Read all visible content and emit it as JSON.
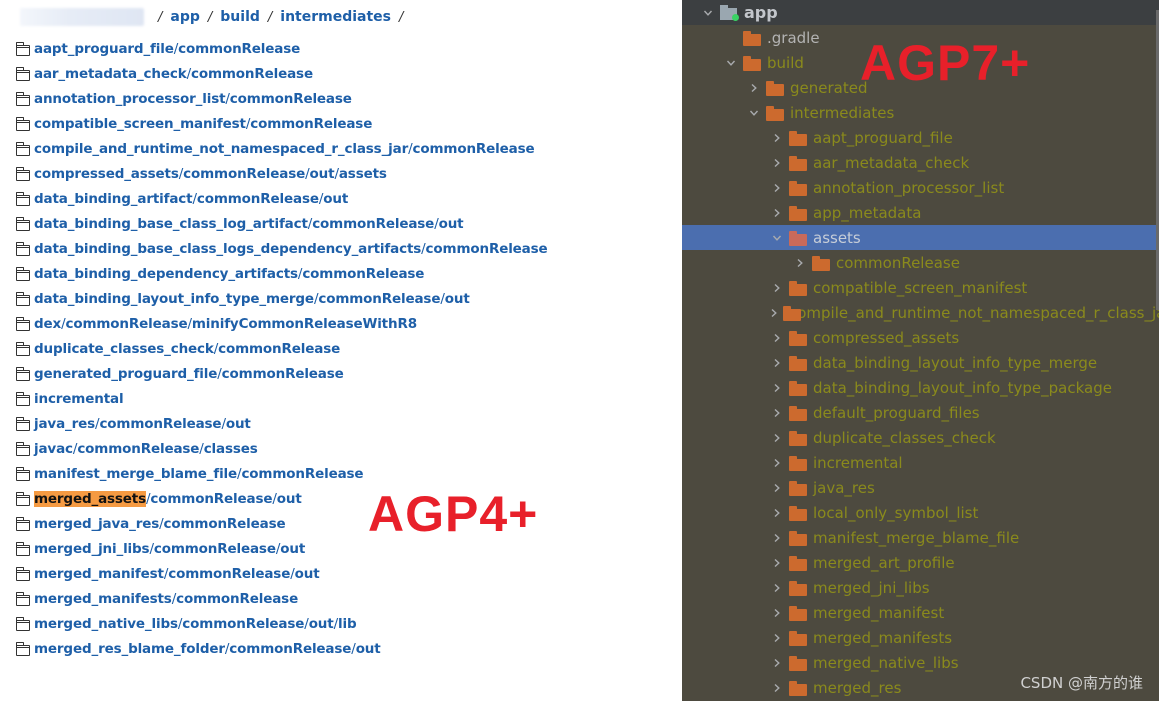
{
  "left_panel": {
    "breadcrumb": {
      "items": [
        "app",
        "build",
        "intermediates"
      ],
      "separator": "/"
    },
    "entries": [
      {
        "segments": [
          "aapt_proguard_file",
          "commonRelease"
        ]
      },
      {
        "segments": [
          "aar_metadata_check",
          "commonRelease"
        ]
      },
      {
        "segments": [
          "annotation_processor_list",
          "commonRelease"
        ]
      },
      {
        "segments": [
          "compatible_screen_manifest",
          "commonRelease"
        ]
      },
      {
        "segments": [
          "compile_and_runtime_not_namespaced_r_class_jar",
          "commonRelease"
        ]
      },
      {
        "segments": [
          "compressed_assets",
          "commonRelease",
          "out",
          "assets"
        ]
      },
      {
        "segments": [
          "data_binding_artifact",
          "commonRelease",
          "out"
        ]
      },
      {
        "segments": [
          "data_binding_base_class_log_artifact",
          "commonRelease",
          "out"
        ]
      },
      {
        "segments": [
          "data_binding_base_class_logs_dependency_artifacts",
          "commonRelease"
        ]
      },
      {
        "segments": [
          "data_binding_dependency_artifacts",
          "commonRelease"
        ]
      },
      {
        "segments": [
          "data_binding_layout_info_type_merge",
          "commonRelease",
          "out"
        ]
      },
      {
        "segments": [
          "dex",
          "commonRelease",
          "minifyCommonReleaseWithR8"
        ]
      },
      {
        "segments": [
          "duplicate_classes_check",
          "commonRelease"
        ]
      },
      {
        "segments": [
          "generated_proguard_file",
          "commonRelease"
        ]
      },
      {
        "segments": [
          "incremental"
        ]
      },
      {
        "segments": [
          "java_res",
          "commonRelease",
          "out"
        ]
      },
      {
        "segments": [
          "javac",
          "commonRelease",
          "classes"
        ]
      },
      {
        "segments": [
          "manifest_merge_blame_file",
          "commonRelease"
        ]
      },
      {
        "segments": [
          "merged_assets",
          "commonRelease",
          "out"
        ],
        "highlight_first": true
      },
      {
        "segments": [
          "merged_java_res",
          "commonRelease"
        ]
      },
      {
        "segments": [
          "merged_jni_libs",
          "commonRelease",
          "out"
        ]
      },
      {
        "segments": [
          "merged_manifest",
          "commonRelease",
          "out"
        ]
      },
      {
        "segments": [
          "merged_manifests",
          "commonRelease"
        ]
      },
      {
        "segments": [
          "merged_native_libs",
          "commonRelease",
          "out",
          "lib"
        ]
      },
      {
        "segments": [
          "merged_res_blame_folder",
          "commonRelease",
          "out"
        ]
      }
    ],
    "highlight_color": "#f59a42",
    "annotation": "AGP4+"
  },
  "right_panel": {
    "annotation": "AGP7+",
    "watermark": "CSDN @南方的谁",
    "tree": [
      {
        "label": "app",
        "depth": 0,
        "expanded": true,
        "type": "module"
      },
      {
        "label": ".gradle",
        "depth": 1,
        "expanded": null,
        "type": "folder",
        "plain": true
      },
      {
        "label": "build",
        "depth": 1,
        "expanded": true,
        "type": "folder"
      },
      {
        "label": "generated",
        "depth": 2,
        "expanded": false,
        "type": "folder"
      },
      {
        "label": "intermediates",
        "depth": 2,
        "expanded": true,
        "type": "folder"
      },
      {
        "label": "aapt_proguard_file",
        "depth": 3,
        "expanded": false,
        "type": "folder"
      },
      {
        "label": "aar_metadata_check",
        "depth": 3,
        "expanded": false,
        "type": "folder"
      },
      {
        "label": "annotation_processor_list",
        "depth": 3,
        "expanded": false,
        "type": "folder"
      },
      {
        "label": "app_metadata",
        "depth": 3,
        "expanded": false,
        "type": "folder"
      },
      {
        "label": "assets",
        "depth": 3,
        "expanded": true,
        "type": "folder",
        "selected": true
      },
      {
        "label": "commonRelease",
        "depth": 4,
        "expanded": false,
        "type": "folder"
      },
      {
        "label": "compatible_screen_manifest",
        "depth": 3,
        "expanded": false,
        "type": "folder"
      },
      {
        "label": "compile_and_runtime_not_namespaced_r_class_jar",
        "depth": 3,
        "expanded": false,
        "type": "folder"
      },
      {
        "label": "compressed_assets",
        "depth": 3,
        "expanded": false,
        "type": "folder"
      },
      {
        "label": "data_binding_layout_info_type_merge",
        "depth": 3,
        "expanded": false,
        "type": "folder"
      },
      {
        "label": "data_binding_layout_info_type_package",
        "depth": 3,
        "expanded": false,
        "type": "folder"
      },
      {
        "label": "default_proguard_files",
        "depth": 3,
        "expanded": false,
        "type": "folder"
      },
      {
        "label": "duplicate_classes_check",
        "depth": 3,
        "expanded": false,
        "type": "folder"
      },
      {
        "label": "incremental",
        "depth": 3,
        "expanded": false,
        "type": "folder"
      },
      {
        "label": "java_res",
        "depth": 3,
        "expanded": false,
        "type": "folder"
      },
      {
        "label": "local_only_symbol_list",
        "depth": 3,
        "expanded": false,
        "type": "folder"
      },
      {
        "label": "manifest_merge_blame_file",
        "depth": 3,
        "expanded": false,
        "type": "folder"
      },
      {
        "label": "merged_art_profile",
        "depth": 3,
        "expanded": false,
        "type": "folder"
      },
      {
        "label": "merged_jni_libs",
        "depth": 3,
        "expanded": false,
        "type": "folder"
      },
      {
        "label": "merged_manifest",
        "depth": 3,
        "expanded": false,
        "type": "folder"
      },
      {
        "label": "merged_manifests",
        "depth": 3,
        "expanded": false,
        "type": "folder"
      },
      {
        "label": "merged_native_libs",
        "depth": 3,
        "expanded": false,
        "type": "folder"
      },
      {
        "label": "merged_res",
        "depth": 3,
        "expanded": false,
        "type": "folder"
      }
    ],
    "colors": {
      "background": "#4d4a3f",
      "header": "#3c3f41",
      "selection": "#4b6eaf",
      "folder": "#cc6a2e",
      "folder_selected": "#c96a5a",
      "label": "#8a8a1c"
    }
  }
}
